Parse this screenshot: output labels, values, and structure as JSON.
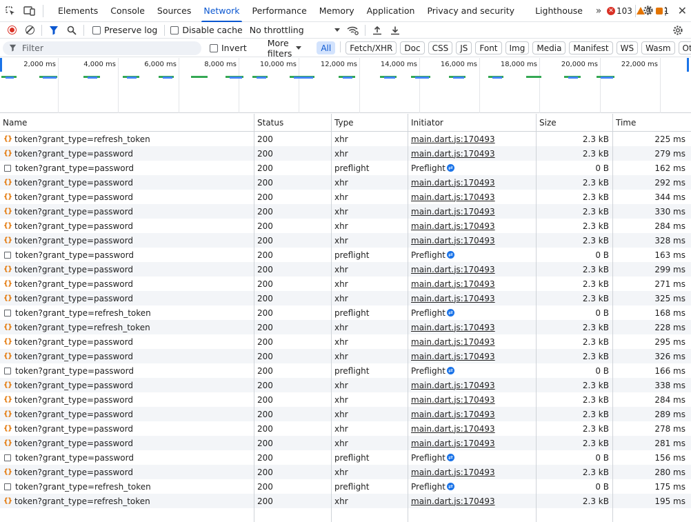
{
  "tabs": [
    {
      "label": "Elements"
    },
    {
      "label": "Console"
    },
    {
      "label": "Sources"
    },
    {
      "label": "Network"
    },
    {
      "label": "Performance"
    },
    {
      "label": "Memory"
    },
    {
      "label": "Application"
    },
    {
      "label": "Privacy and security"
    },
    {
      "label": "Lighthouse"
    }
  ],
  "active_tab": "Network",
  "issues": {
    "errors": "103",
    "warnings": "3",
    "info": "1"
  },
  "toolbar": {
    "preserve_log": "Preserve log",
    "disable_cache": "Disable cache",
    "throttling": "No throttling"
  },
  "filter": {
    "placeholder": "Filter",
    "invert": "Invert",
    "more_filters": "More filters",
    "chips": [
      "All",
      "Fetch/XHR",
      "Doc",
      "CSS",
      "JS",
      "Font",
      "Img",
      "Media",
      "Manifest",
      "WS",
      "Wasm",
      "Other"
    ],
    "active_chip": "All"
  },
  "overview": {
    "ticks": [
      "2,000 ms",
      "4,000 ms",
      "6,000 ms",
      "8,000 ms",
      "10,000 ms",
      "12,000 ms",
      "14,000 ms",
      "16,000 ms",
      "18,000 ms",
      "20,000 ms",
      "22,000 ms"
    ],
    "colors": {
      "green": "#34a853",
      "blue": "#4285f4"
    }
  },
  "columns": {
    "name": "Name",
    "status": "Status",
    "type": "Type",
    "initiator": "Initiator",
    "size": "Size",
    "time": "Time"
  },
  "rows": [
    {
      "kind": "xhr",
      "name": "token?grant_type=refresh_token",
      "status": "200",
      "type": "xhr",
      "initiator": "main.dart.js:170493",
      "size": "2.3 kB",
      "time": "225 ms"
    },
    {
      "kind": "xhr",
      "name": "token?grant_type=password",
      "status": "200",
      "type": "xhr",
      "initiator": "main.dart.js:170493",
      "size": "2.3 kB",
      "time": "279 ms"
    },
    {
      "kind": "preflight",
      "name": "token?grant_type=password",
      "status": "200",
      "type": "preflight",
      "initiator": "Preflight",
      "size": "0 B",
      "time": "162 ms"
    },
    {
      "kind": "xhr",
      "name": "token?grant_type=password",
      "status": "200",
      "type": "xhr",
      "initiator": "main.dart.js:170493",
      "size": "2.3 kB",
      "time": "292 ms"
    },
    {
      "kind": "xhr",
      "name": "token?grant_type=password",
      "status": "200",
      "type": "xhr",
      "initiator": "main.dart.js:170493",
      "size": "2.3 kB",
      "time": "344 ms"
    },
    {
      "kind": "xhr",
      "name": "token?grant_type=password",
      "status": "200",
      "type": "xhr",
      "initiator": "main.dart.js:170493",
      "size": "2.3 kB",
      "time": "330 ms"
    },
    {
      "kind": "xhr",
      "name": "token?grant_type=password",
      "status": "200",
      "type": "xhr",
      "initiator": "main.dart.js:170493",
      "size": "2.3 kB",
      "time": "284 ms"
    },
    {
      "kind": "xhr",
      "name": "token?grant_type=password",
      "status": "200",
      "type": "xhr",
      "initiator": "main.dart.js:170493",
      "size": "2.3 kB",
      "time": "328 ms"
    },
    {
      "kind": "preflight",
      "name": "token?grant_type=password",
      "status": "200",
      "type": "preflight",
      "initiator": "Preflight",
      "size": "0 B",
      "time": "163 ms"
    },
    {
      "kind": "xhr",
      "name": "token?grant_type=password",
      "status": "200",
      "type": "xhr",
      "initiator": "main.dart.js:170493",
      "size": "2.3 kB",
      "time": "299 ms"
    },
    {
      "kind": "xhr",
      "name": "token?grant_type=password",
      "status": "200",
      "type": "xhr",
      "initiator": "main.dart.js:170493",
      "size": "2.3 kB",
      "time": "271 ms"
    },
    {
      "kind": "xhr",
      "name": "token?grant_type=password",
      "status": "200",
      "type": "xhr",
      "initiator": "main.dart.js:170493",
      "size": "2.3 kB",
      "time": "325 ms"
    },
    {
      "kind": "preflight",
      "name": "token?grant_type=refresh_token",
      "status": "200",
      "type": "preflight",
      "initiator": "Preflight",
      "size": "0 B",
      "time": "168 ms"
    },
    {
      "kind": "xhr",
      "name": "token?grant_type=refresh_token",
      "status": "200",
      "type": "xhr",
      "initiator": "main.dart.js:170493",
      "size": "2.3 kB",
      "time": "228 ms"
    },
    {
      "kind": "xhr",
      "name": "token?grant_type=password",
      "status": "200",
      "type": "xhr",
      "initiator": "main.dart.js:170493",
      "size": "2.3 kB",
      "time": "295 ms"
    },
    {
      "kind": "xhr",
      "name": "token?grant_type=password",
      "status": "200",
      "type": "xhr",
      "initiator": "main.dart.js:170493",
      "size": "2.3 kB",
      "time": "326 ms"
    },
    {
      "kind": "preflight",
      "name": "token?grant_type=password",
      "status": "200",
      "type": "preflight",
      "initiator": "Preflight",
      "size": "0 B",
      "time": "166 ms"
    },
    {
      "kind": "xhr",
      "name": "token?grant_type=password",
      "status": "200",
      "type": "xhr",
      "initiator": "main.dart.js:170493",
      "size": "2.3 kB",
      "time": "338 ms"
    },
    {
      "kind": "xhr",
      "name": "token?grant_type=password",
      "status": "200",
      "type": "xhr",
      "initiator": "main.dart.js:170493",
      "size": "2.3 kB",
      "time": "284 ms"
    },
    {
      "kind": "xhr",
      "name": "token?grant_type=password",
      "status": "200",
      "type": "xhr",
      "initiator": "main.dart.js:170493",
      "size": "2.3 kB",
      "time": "289 ms"
    },
    {
      "kind": "xhr",
      "name": "token?grant_type=password",
      "status": "200",
      "type": "xhr",
      "initiator": "main.dart.js:170493",
      "size": "2.3 kB",
      "time": "278 ms"
    },
    {
      "kind": "xhr",
      "name": "token?grant_type=password",
      "status": "200",
      "type": "xhr",
      "initiator": "main.dart.js:170493",
      "size": "2.3 kB",
      "time": "281 ms"
    },
    {
      "kind": "preflight",
      "name": "token?grant_type=password",
      "status": "200",
      "type": "preflight",
      "initiator": "Preflight",
      "size": "0 B",
      "time": "156 ms"
    },
    {
      "kind": "xhr",
      "name": "token?grant_type=password",
      "status": "200",
      "type": "xhr",
      "initiator": "main.dart.js:170493",
      "size": "2.3 kB",
      "time": "280 ms"
    },
    {
      "kind": "preflight",
      "name": "token?grant_type=refresh_token",
      "status": "200",
      "type": "preflight",
      "initiator": "Preflight",
      "size": "0 B",
      "time": "175 ms"
    },
    {
      "kind": "xhr",
      "name": "token?grant_type=refresh_token",
      "status": "200",
      "type": "xhr",
      "initiator": "main.dart.js:170493",
      "size": "2.3 kB",
      "time": "195 ms"
    }
  ]
}
